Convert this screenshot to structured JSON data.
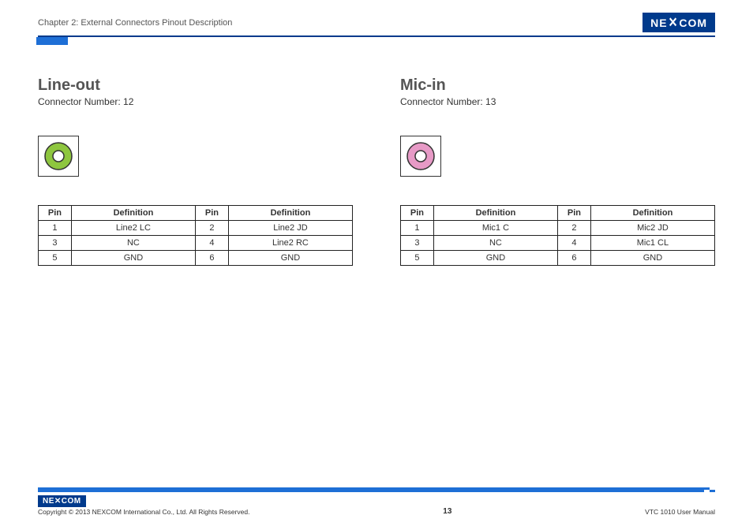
{
  "header": {
    "chapter": "Chapter 2: External Connectors Pinout Description",
    "logo_text": "NE✕COM"
  },
  "sections": [
    {
      "title": "Line-out",
      "conn_label": "Connector Number: 12",
      "jack_color": "#8ec63f",
      "rows": [
        {
          "p1": "1",
          "d1": "Line2 LC",
          "p2": "2",
          "d2": "Line2 JD"
        },
        {
          "p1": "3",
          "d1": "NC",
          "p2": "4",
          "d2": "Line2 RC"
        },
        {
          "p1": "5",
          "d1": "GND",
          "p2": "6",
          "d2": "GND"
        }
      ]
    },
    {
      "title": "Mic-in",
      "conn_label": "Connector Number: 13",
      "jack_color": "#e79ac6",
      "rows": [
        {
          "p1": "1",
          "d1": "Mic1 C",
          "p2": "2",
          "d2": "Mic2 JD"
        },
        {
          "p1": "3",
          "d1": "NC",
          "p2": "4",
          "d2": "Mic1 CL"
        },
        {
          "p1": "5",
          "d1": "GND",
          "p2": "6",
          "d2": "GND"
        }
      ]
    }
  ],
  "table_headers": {
    "pin": "Pin",
    "def": "Definition"
  },
  "footer": {
    "logo_text": "NE✕COM",
    "copyright": "Copyright © 2013 NEXCOM International Co., Ltd. All Rights Reserved.",
    "page": "13",
    "manual": "VTC 1010 User Manual"
  }
}
